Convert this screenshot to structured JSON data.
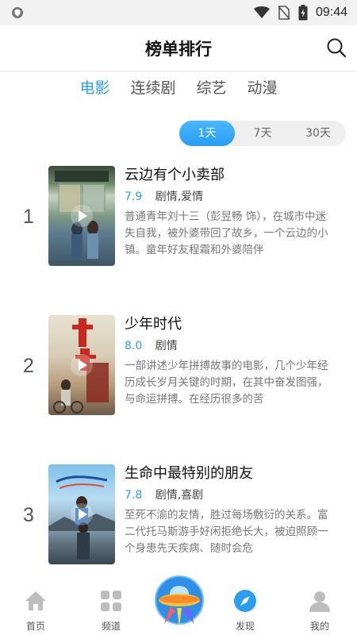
{
  "status_bar": {
    "time": "09:44"
  },
  "header": {
    "title": "榜单排行"
  },
  "category_tabs": [
    {
      "label": "电影",
      "active": true
    },
    {
      "label": "连续剧",
      "active": false
    },
    {
      "label": "综艺",
      "active": false
    },
    {
      "label": "动漫",
      "active": false
    }
  ],
  "period_switch": [
    {
      "label": "1天",
      "active": true
    },
    {
      "label": "7天",
      "active": false
    },
    {
      "label": "30天",
      "active": false
    }
  ],
  "rankings": [
    {
      "rank": "1",
      "title": "云边有个小卖部",
      "score": "7.9",
      "genre": "剧情,爱情",
      "desc": "普通青年刘十三（彭昱畅 饰），在城市中迷失自我，被外婆带回了故乡，一个云边的小镇。童年好友程霜和外婆陪伴"
    },
    {
      "rank": "2",
      "title": "少年时代",
      "score": "8.0",
      "genre": "剧情",
      "desc": "一部讲述少年拼搏故事的电影，几个少年经历成长岁月关键的时期，在其中奋发图强，与命运拼搏。在经历很多的苦"
    },
    {
      "rank": "3",
      "title": "生命中最特别的朋友",
      "score": "7.8",
      "genre": "剧情,喜剧",
      "desc": "至死不渝的友情，胜过每场敷衍的关系。富二代托马斯游手好闲拒绝长大，被迫照顾一个身患先天疾病、随时会危"
    }
  ],
  "bottom_nav": [
    {
      "label": "首页",
      "icon": "home-icon"
    },
    {
      "label": "频道",
      "icon": "grid-icon"
    },
    {
      "label": "发现",
      "icon": "compass-icon"
    },
    {
      "label": "我的",
      "icon": "user-icon"
    }
  ],
  "colors": {
    "accent": "#2b9ef2",
    "muted": "#777777"
  }
}
